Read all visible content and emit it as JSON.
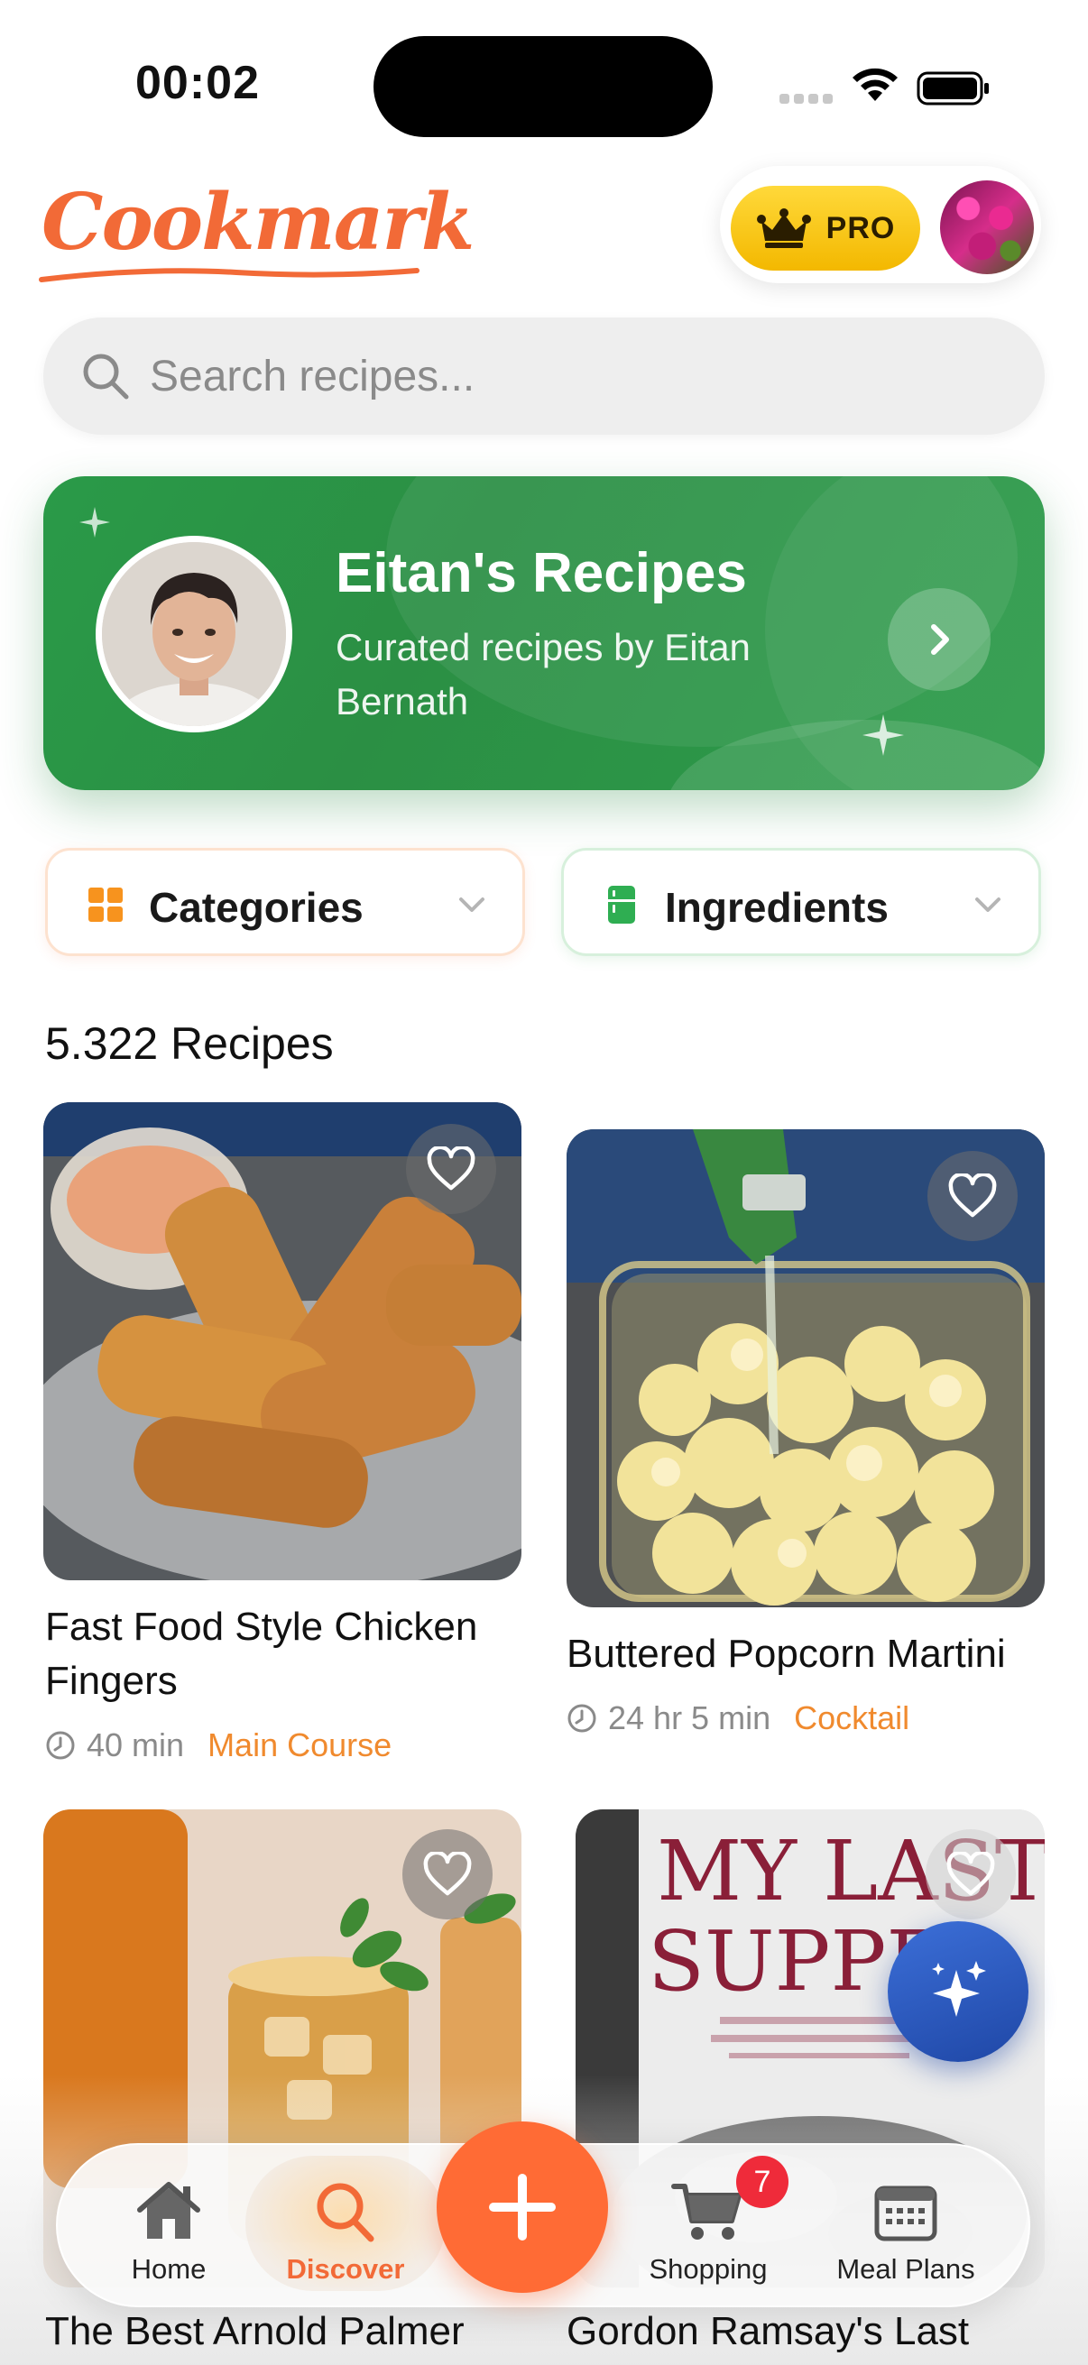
{
  "status_bar": {
    "time": "00:02"
  },
  "header": {
    "logo": "Cookmark",
    "pro_label": "PRO",
    "colors": {
      "brand": "#f26a37",
      "pro": "#f5c400"
    }
  },
  "search": {
    "placeholder": "Search recipes..."
  },
  "banner": {
    "title": "Eitan's Recipes",
    "subtitle": "Curated recipes by Eitan Bernath",
    "color": "#2b9446"
  },
  "filters": {
    "categories": "Categories",
    "ingredients": "Ingredients"
  },
  "recipe_count": "5.322 Recipes",
  "recipes": [
    {
      "title": "Fast Food Style Chicken Fingers",
      "time": "40 min",
      "category": "Main Course"
    },
    {
      "title": "Buttered Popcorn Martini",
      "time": "24 hr 5 min",
      "category": "Cocktail"
    },
    {
      "title": "The Best Arnold Palmer"
    },
    {
      "title": "Gordon Ramsay's Last",
      "image_text": [
        "MY LAST",
        "SUPPE"
      ]
    }
  ],
  "tabbar": {
    "home": "Home",
    "discover": "Discover",
    "shopping": "Shopping",
    "shopping_badge": "7",
    "meal_plans": "Meal Plans",
    "active": "discover"
  }
}
